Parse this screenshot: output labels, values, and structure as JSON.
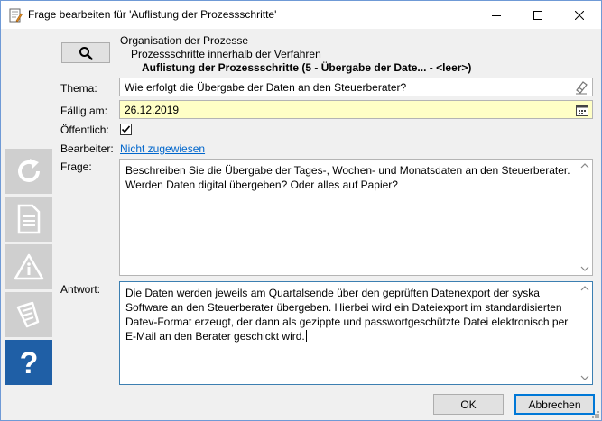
{
  "window": {
    "title": "Frage bearbeiten für 'Auflistung der Prozessschritte'"
  },
  "breadcrumb": {
    "level1": "Organisation der Prozesse",
    "level2": "Prozessschritte innerhalb der Verfahren",
    "level3": "Auflistung der Prozessschritte (5 - Übergabe der Date... - <leer>)"
  },
  "form": {
    "thema_label": "Thema:",
    "thema_value": "Wie erfolgt die Übergabe der Daten an den Steuerberater?",
    "faellig_label": "Fällig am:",
    "faellig_value": "26.12.2019",
    "oeffentlich_label": "Öffentlich:",
    "oeffentlich_checked": true,
    "bearbeiter_label": "Bearbeiter:",
    "bearbeiter_link": "Nicht zugewiesen",
    "frage_label": "Frage:",
    "frage_text": "Beschreiben Sie die Übergabe der Tages-, Wochen- und Monatsdaten an den Steuerberater.\nWerden Daten digital übergeben? Oder alles auf Papier?",
    "antwort_label": "Antwort:",
    "antwort_text": "Die Daten werden jeweils am Quartalsende über den geprüften Datenexport der syska Software an den Steuerberater übergeben. Hierbei wird ein Dateiexport im standardisierten Datev-Format erzeugt, der dann als gezippte und passwortgeschützte Datei elektronisch per E-Mail an den Berater geschickt wird."
  },
  "buttons": {
    "ok": "OK",
    "cancel": "Abbrechen"
  },
  "sidebar": {
    "items": [
      {
        "icon": "refresh-icon"
      },
      {
        "icon": "document-icon"
      },
      {
        "icon": "warning-icon"
      },
      {
        "icon": "note-icon"
      },
      {
        "icon": "help-icon",
        "active": true
      }
    ]
  },
  "colors": {
    "accent": "#1f5fa6",
    "date_field_bg": "#ffffc6",
    "link": "#0066cc"
  }
}
